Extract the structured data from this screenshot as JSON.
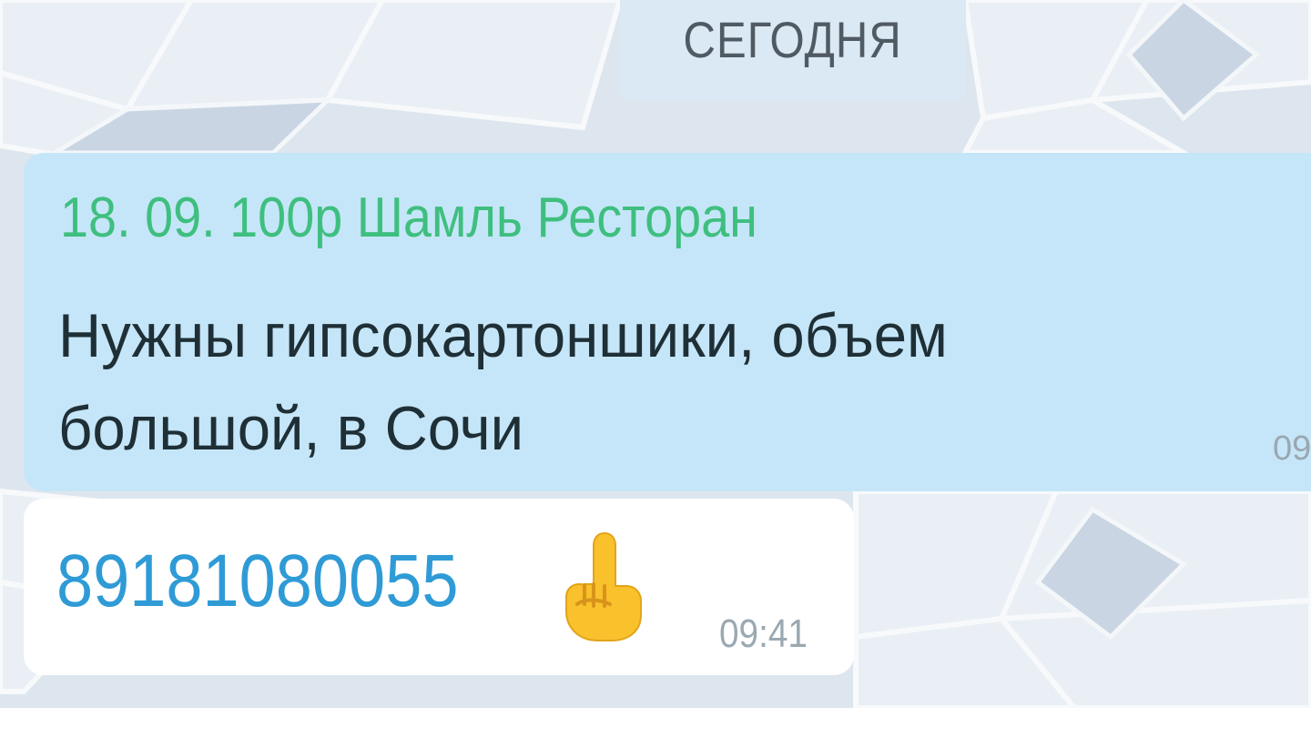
{
  "date_separator": "СЕГОДНЯ",
  "message_quoted": {
    "title": "18. 09. 100р Шамль Ресторан",
    "body_lines": [
      "Нужны гипсокартоншики, объем",
      "большой, в Сочи"
    ],
    "time": "09"
  },
  "message_phone": {
    "text": "89181080055",
    "emoji": "pointing-up-finger-icon",
    "time": "09:41"
  },
  "colors": {
    "quoted_bubble": "#c5e6f8",
    "title_green": "#3fbf7f",
    "phone_link": "#2f9bd6",
    "time_gray": "#9aa8b1",
    "chip_bg": "#dbe9f4"
  }
}
